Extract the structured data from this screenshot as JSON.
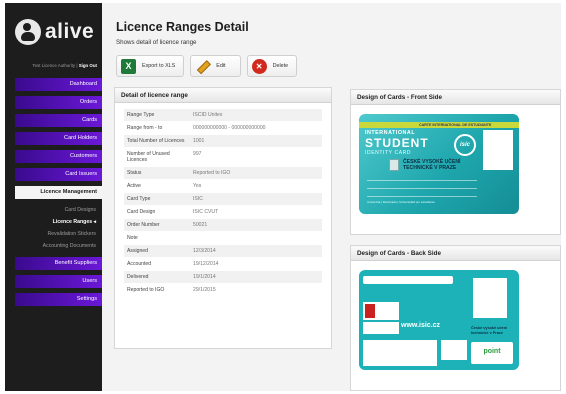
{
  "brand": {
    "name": "alive"
  },
  "user": {
    "text": "Test Licence Authority",
    "separator": " | ",
    "signout": "Sign Out"
  },
  "nav": {
    "items": [
      {
        "label": "Dashboard"
      },
      {
        "label": "Orders"
      },
      {
        "label": "Cards"
      },
      {
        "label": "Card Holders"
      },
      {
        "label": "Customers"
      },
      {
        "label": "Card Issuers"
      }
    ],
    "active": {
      "label": "Licence Management"
    },
    "subitems": [
      {
        "label": "Card Designs"
      },
      {
        "label": "Licence Ranges"
      },
      {
        "label": "Revalidation Stickers"
      },
      {
        "label": "Accounting Documents"
      }
    ],
    "bottom_items": [
      {
        "label": "Benefit Suppliers"
      },
      {
        "label": "Users"
      },
      {
        "label": "Settings"
      }
    ]
  },
  "page": {
    "title": "Licence Ranges Detail",
    "subtitle": "Shows detail of licence range"
  },
  "toolbar": {
    "export_label": "Export to XLS",
    "edit_label": "Edit",
    "delete_label": "Delete"
  },
  "detail": {
    "title": "Detail of licence range",
    "rows": [
      {
        "label": "Range Type",
        "value": "ISCID Unitex"
      },
      {
        "label": "Range from - to",
        "value": "000000000000 - 000000000000"
      },
      {
        "label": "Total Number of Licences",
        "value": "1001"
      },
      {
        "label": "Number of Unused Licences",
        "value": "997"
      },
      {
        "label": "Status",
        "value": "Reported to IGO"
      },
      {
        "label": "Active",
        "value": "Yes"
      },
      {
        "label": "Card Type",
        "value": "ISIC"
      },
      {
        "label": "Card Design",
        "value": "ISIC CVUT"
      },
      {
        "label": "Order Number",
        "value": "50021"
      },
      {
        "label": "Note",
        "value": ""
      },
      {
        "label": "Assigned",
        "value": "12/3/2014"
      },
      {
        "label": "Accounted",
        "value": "19/12/2014"
      },
      {
        "label": "Delivered",
        "value": "19/1/2014"
      },
      {
        "label": "Reported to IGO",
        "value": "29/1/2015"
      }
    ]
  },
  "front": {
    "title": "Design of Cards - Front Side",
    "card": {
      "band": "CARTE INTERNATIONAL DE ESTUDIANTE",
      "international": "INTERNATIONAL",
      "student": "STUDENT",
      "identity": "IDENTITY CARD",
      "logo": "isic",
      "university": "ČESKÉ VYSOKÉ UČENÍ TECHNICKÉ V PRAZE",
      "footer": "Univerzita | Rectorado | Universidad por estudiante"
    }
  },
  "back": {
    "title": "Design of Cards - Back Side",
    "card": {
      "url": "www.isic.cz",
      "university": "České vysoké učení technické v Praze",
      "point": "point"
    }
  }
}
